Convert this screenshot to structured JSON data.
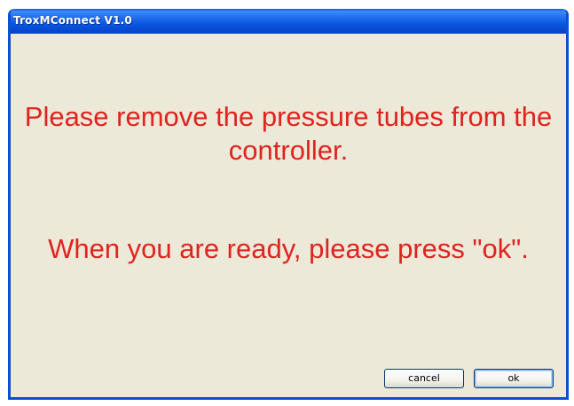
{
  "window": {
    "title": "TroxMConnect V1.0"
  },
  "message": {
    "line1": "Please remove the pressure tubes from the controller.",
    "line2": "When you are ready, please press \"ok\"."
  },
  "buttons": {
    "cancel_label": "cancel",
    "ok_label": "ok"
  },
  "colors": {
    "message_text": "#e0231f",
    "titlebar": "#0a58df",
    "dialog_background": "#ece9d8"
  }
}
